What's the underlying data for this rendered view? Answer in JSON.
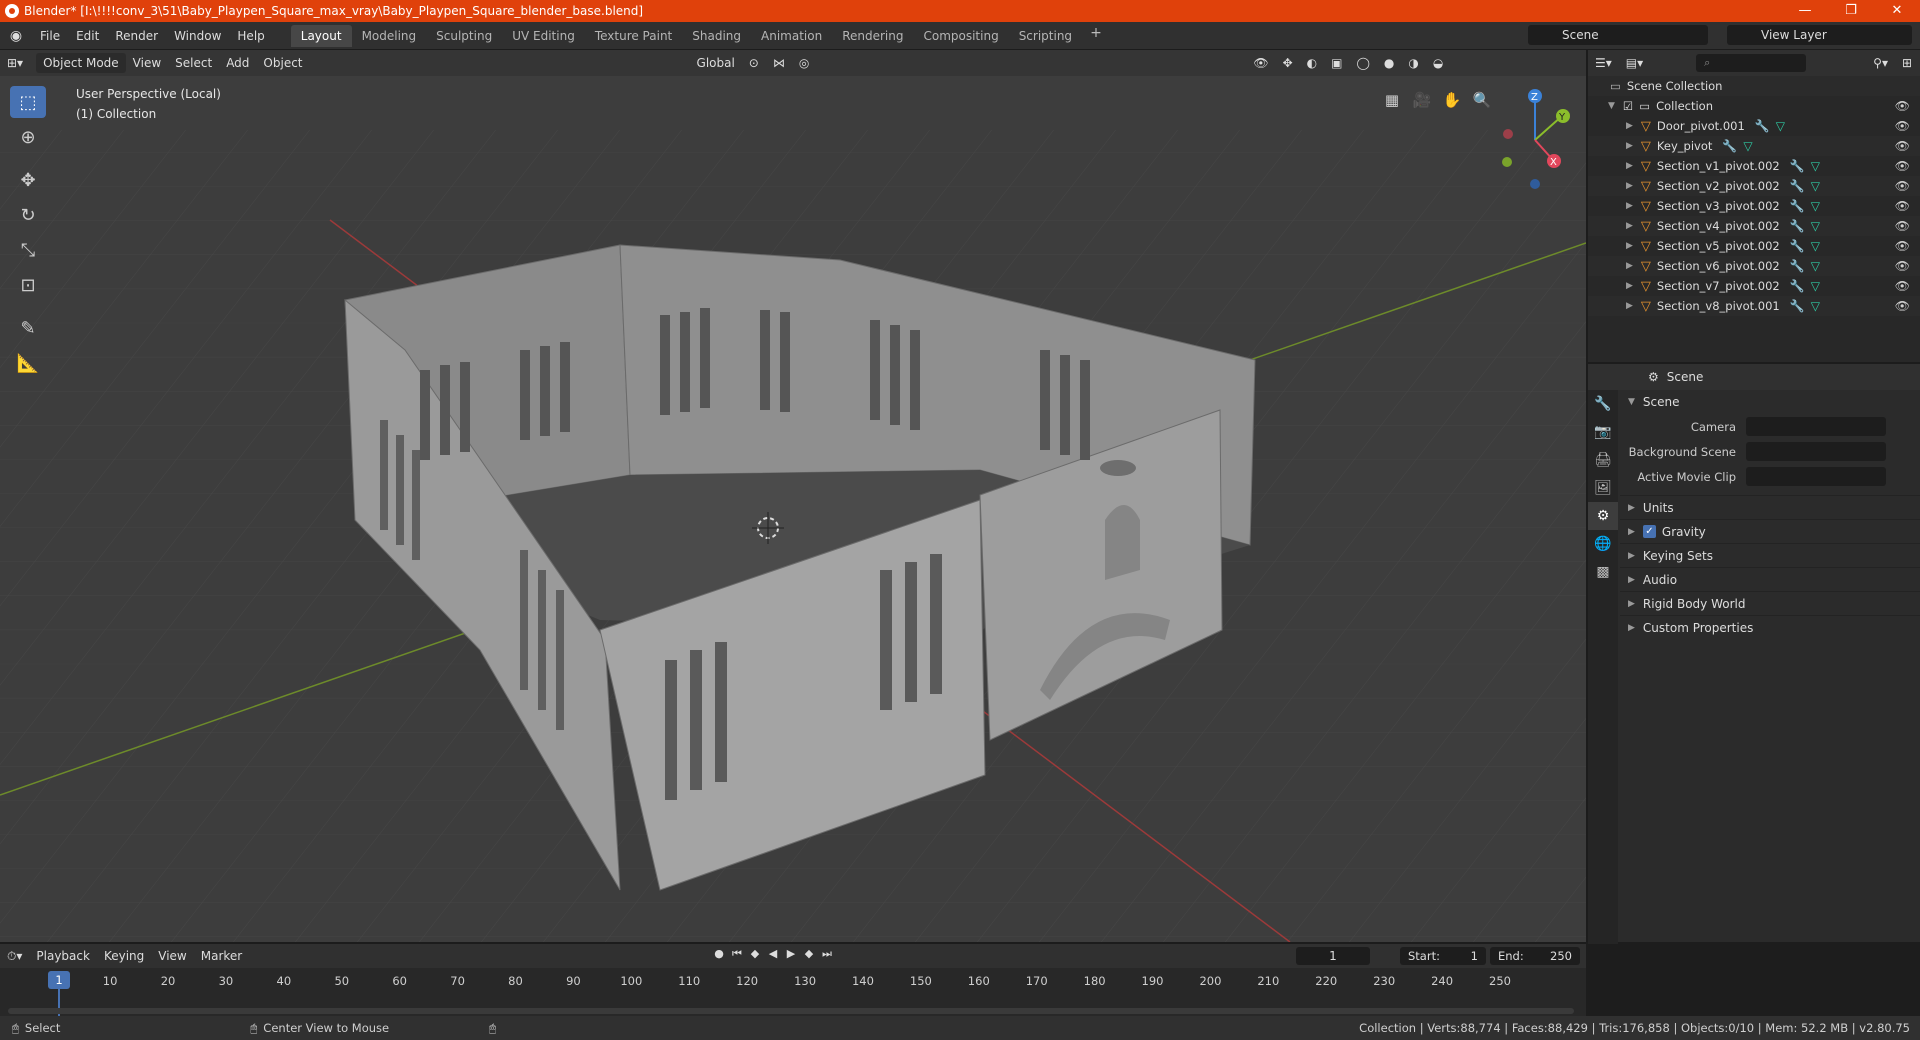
{
  "window": {
    "title": "Blender* [I:\\!!!!conv_3\\51\\Baby_Playpen_Square_max_vray\\Baby_Playpen_Square_blender_base.blend]",
    "controls": [
      "—",
      "❐",
      "✕"
    ]
  },
  "menu": [
    "File",
    "Edit",
    "Render",
    "Window",
    "Help"
  ],
  "workspaces": [
    "Layout",
    "Modeling",
    "Sculpting",
    "UV Editing",
    "Texture Paint",
    "Shading",
    "Animation",
    "Rendering",
    "Compositing",
    "Scripting"
  ],
  "active_workspace": "Layout",
  "scene_name": "Scene",
  "view_layer": "View Layer",
  "viewport": {
    "mode": "Object Mode",
    "menus": [
      "View",
      "Select",
      "Add",
      "Object"
    ],
    "orientation": "Global",
    "perspective_label": "User Perspective (Local)",
    "collection_label": "(1) Collection",
    "axis_labels": {
      "x": "X",
      "y": "Y",
      "z": "Z"
    }
  },
  "outliner": {
    "root": "Scene Collection",
    "collection": "Collection",
    "objects": [
      "Door_pivot.001",
      "Key_pivot",
      "Section_v1_pivot.002",
      "Section_v2_pivot.002",
      "Section_v3_pivot.002",
      "Section_v4_pivot.002",
      "Section_v5_pivot.002",
      "Section_v6_pivot.002",
      "Section_v7_pivot.002",
      "Section_v8_pivot.001"
    ]
  },
  "properties": {
    "header": "Scene",
    "panel": "Scene",
    "fields": {
      "camera": "Camera",
      "background_scene": "Background Scene",
      "active_movie_clip": "Active Movie Clip"
    },
    "subpanels": {
      "units": "Units",
      "gravity": "Gravity",
      "keying_sets": "Keying Sets",
      "audio": "Audio",
      "rigid_body_world": "Rigid Body World",
      "custom_properties": "Custom Properties"
    }
  },
  "timeline": {
    "menus": [
      "Playback",
      "Keying",
      "View",
      "Marker"
    ],
    "current_frame": "1",
    "start_label": "Start:",
    "start": "1",
    "end_label": "End:",
    "end": "250",
    "ticks": [
      "1",
      "10",
      "20",
      "30",
      "40",
      "50",
      "60",
      "70",
      "80",
      "90",
      "100",
      "110",
      "120",
      "130",
      "140",
      "150",
      "160",
      "170",
      "180",
      "190",
      "200",
      "210",
      "220",
      "230",
      "240",
      "250"
    ]
  },
  "status": {
    "left_action": "Select",
    "middle_action": "Center View to Mouse",
    "stats": "Collection | Verts:88,774 | Faces:88,429 | Tris:176,858 | Objects:0/10 | Mem: 52.2 MB | v2.80.75"
  }
}
